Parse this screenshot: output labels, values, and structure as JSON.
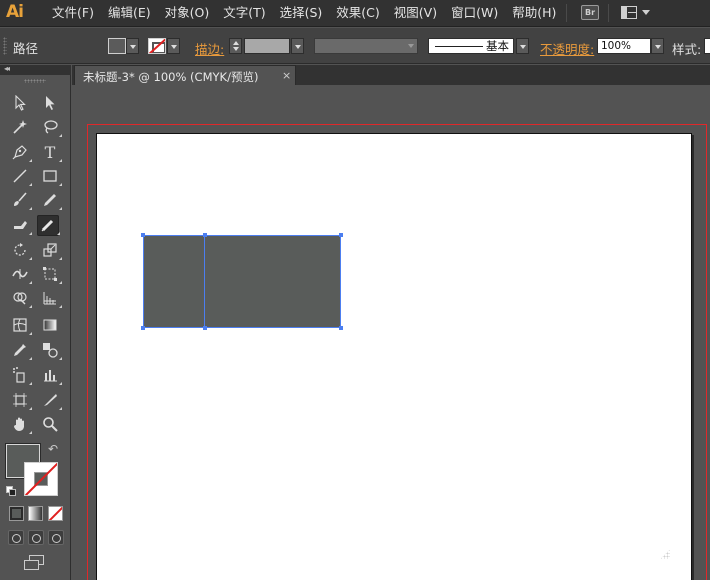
{
  "app": {
    "logo": "Ai"
  },
  "menubar": {
    "items": [
      "文件(F)",
      "编辑(E)",
      "对象(O)",
      "文字(T)",
      "选择(S)",
      "效果(C)",
      "视图(V)",
      "窗口(W)",
      "帮助(H)"
    ],
    "bridge_label": "Br"
  },
  "control_bar": {
    "object_type": "路径",
    "stroke_label": "描边:",
    "stroke_weight": "",
    "brush_label": "基本",
    "opacity_label": "不透明度:",
    "opacity_value": "100%",
    "style_label": "样式:"
  },
  "document": {
    "tab_title": "未标题-3* @ 100% (CMYK/预览)",
    "close_glyph": "×"
  },
  "toolbox": {
    "collapse_glyph": "◂◂",
    "swap_glyph": "↶"
  },
  "colors": {
    "fill": "#595c5a",
    "selection": "#4c7ef0",
    "bleed": "#e0282a",
    "accent_orange": "#e89a3c"
  }
}
